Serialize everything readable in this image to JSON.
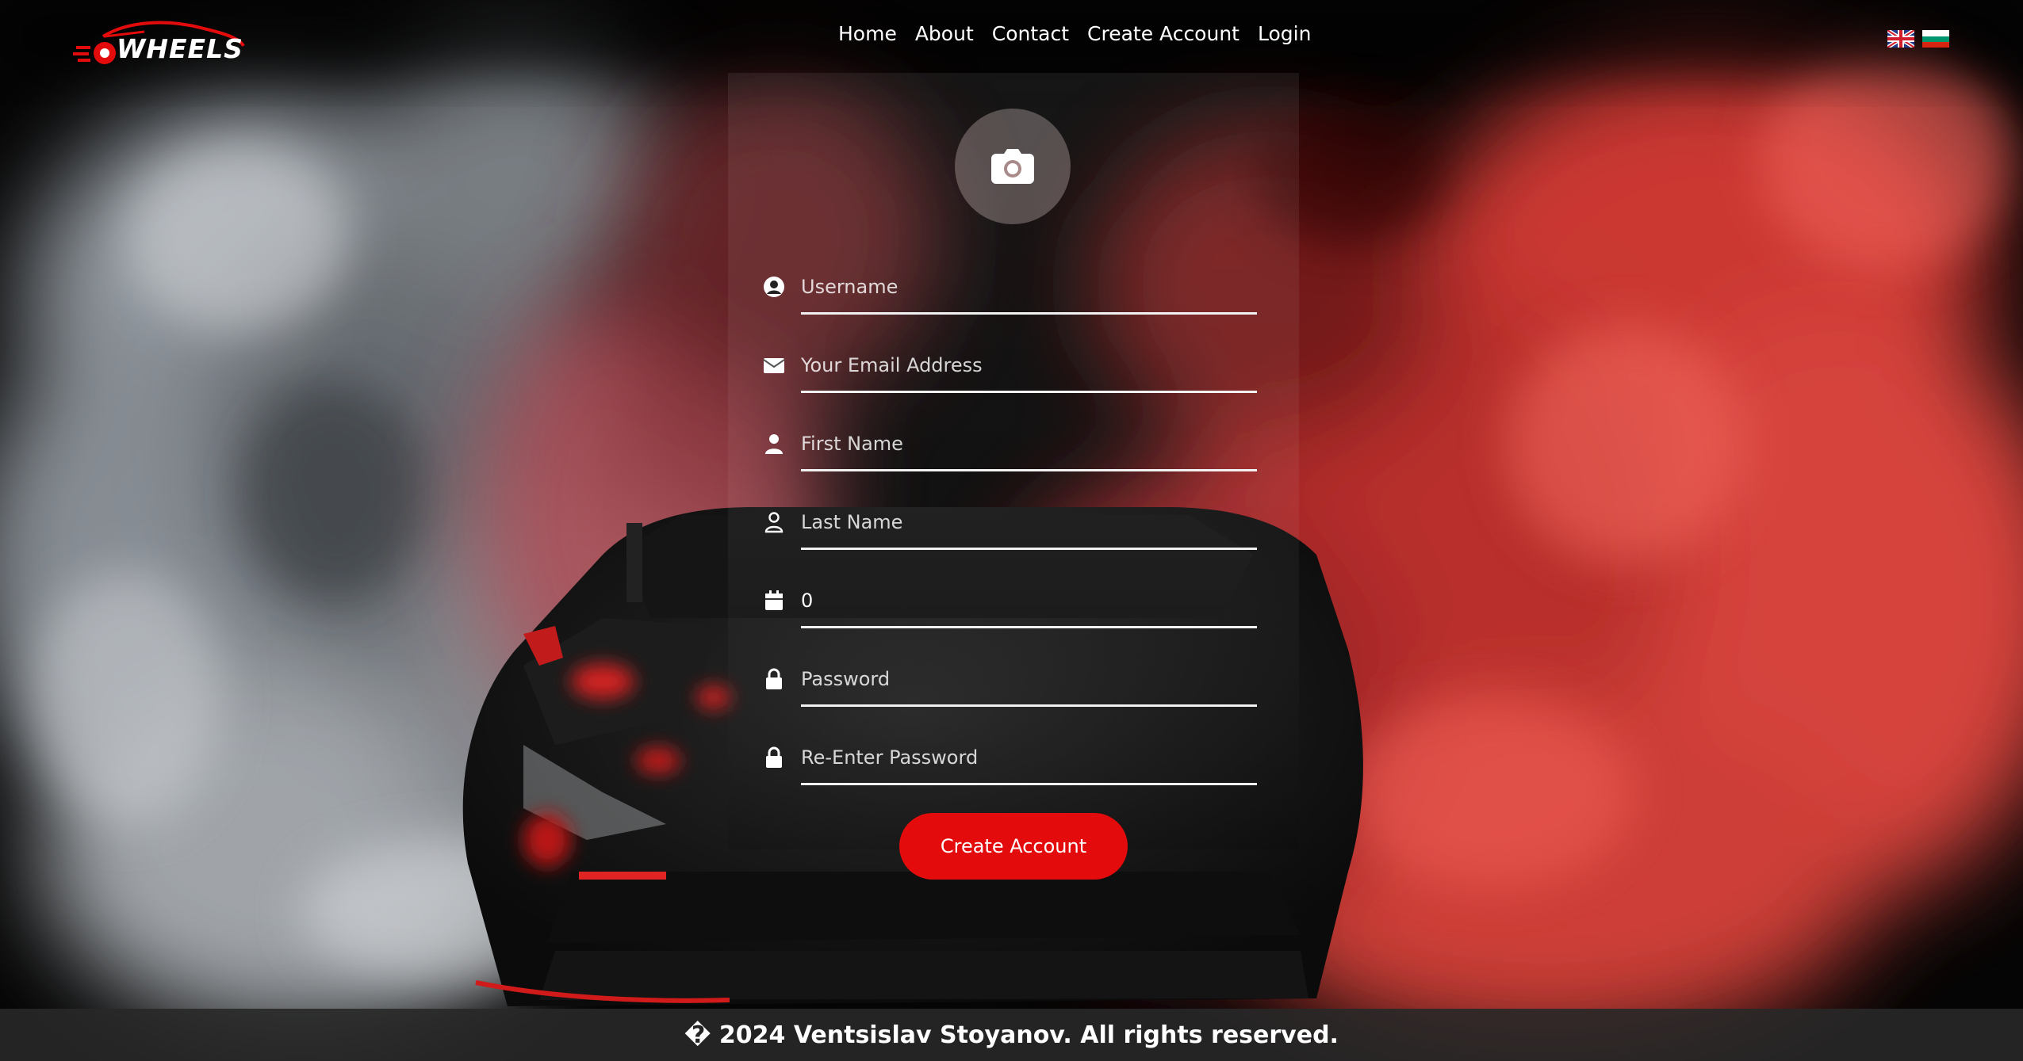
{
  "brand": {
    "name": "WHEELS",
    "accent": "#e30b0b"
  },
  "nav": {
    "items": [
      {
        "label": "Home"
      },
      {
        "label": "About"
      },
      {
        "label": "Contact"
      },
      {
        "label": "Create Account"
      },
      {
        "label": "Login"
      }
    ]
  },
  "languages": [
    {
      "icon": "uk-flag-icon"
    },
    {
      "icon": "bulgaria-flag-icon"
    }
  ],
  "form": {
    "avatar_icon": "camera-icon",
    "fields": [
      {
        "icon": "user-circle-icon",
        "placeholder": "Username",
        "value": ""
      },
      {
        "icon": "envelope-icon",
        "placeholder": "Your Email Address",
        "value": ""
      },
      {
        "icon": "user-icon",
        "placeholder": "First Name",
        "value": ""
      },
      {
        "icon": "user-outline-icon",
        "placeholder": "Last Name",
        "value": ""
      },
      {
        "icon": "calendar-icon",
        "placeholder": "",
        "value": "0"
      },
      {
        "icon": "lock-icon",
        "placeholder": "Password",
        "value": ""
      },
      {
        "icon": "lock-icon",
        "placeholder": "Re-Enter Password",
        "value": ""
      }
    ],
    "submit_label": "Create Account"
  },
  "footer": {
    "text": "� 2024 Ventsislav Stoyanov. All rights reserved."
  }
}
